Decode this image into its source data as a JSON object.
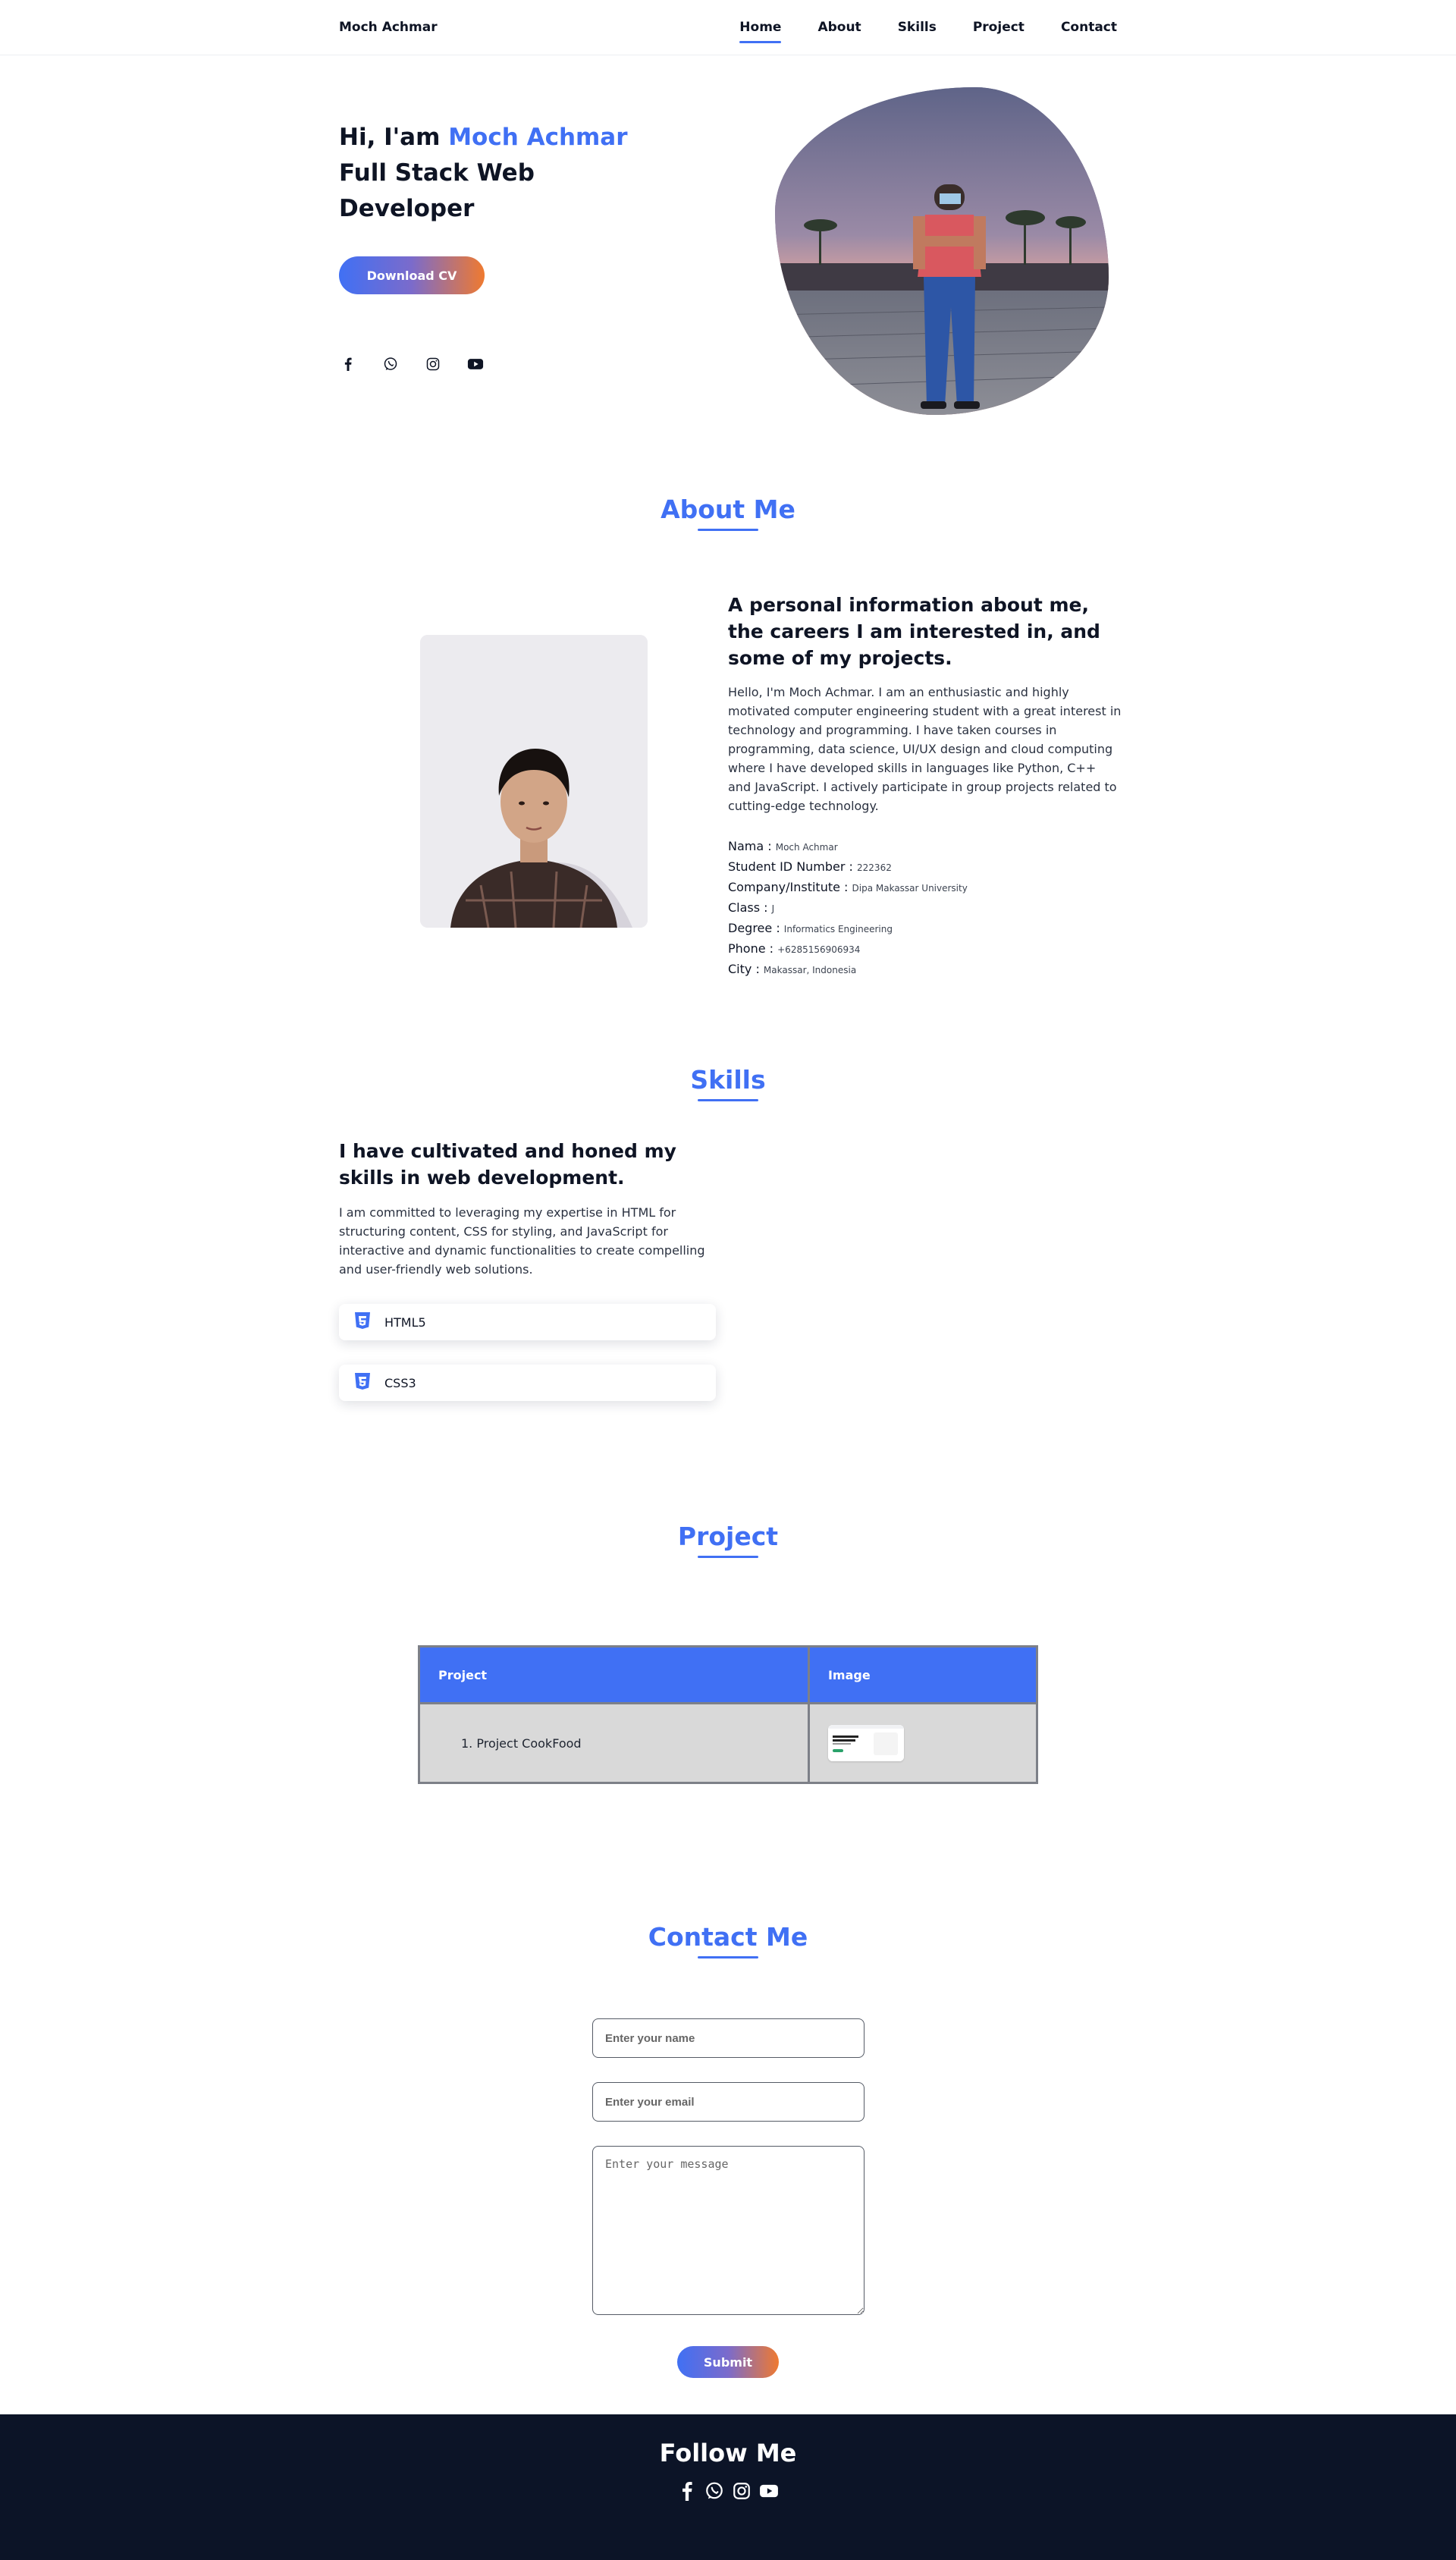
{
  "header": {
    "logo": "Moch Achmar",
    "nav": [
      "Home",
      "About",
      "Skills",
      "Project",
      "Contact"
    ],
    "active": "Home"
  },
  "hero": {
    "greeting": "Hi, I'am ",
    "name": "Moch Achmar",
    "role": "Full Stack Web Developer",
    "cv_button": "Download CV",
    "socials": [
      "facebook-icon",
      "whatsapp-icon",
      "instagram-icon",
      "youtube-icon"
    ]
  },
  "about": {
    "title": "About Me",
    "heading": "A personal information about me, the careers I am interested in, and some of my projects.",
    "text": "Hello, I'm Moch Achmar. I am an enthusiastic and highly motivated computer engineering student with a great interest in technology and programming. I have taken courses in programming, data science, UI/UX design and cloud computing where I have developed skills in languages like Python, C++ and JavaScript. I actively participate in group projects related to cutting-edge technology.",
    "info": [
      {
        "label": "Nama : ",
        "value": "Moch Achmar"
      },
      {
        "label": "Student ID Number : ",
        "value": "222362"
      },
      {
        "label": "Company/Institute : ",
        "value": "Dipa Makassar University"
      },
      {
        "label": "Class : ",
        "value": "J"
      },
      {
        "label": "Degree : ",
        "value": "Informatics Engineering"
      },
      {
        "label": "Phone : ",
        "value": "+6285156906934"
      },
      {
        "label": "City : ",
        "value": "Makassar, Indonesia"
      }
    ]
  },
  "skills": {
    "title": "Skills",
    "heading": "I have cultivated and honed my skills in web development.",
    "text": "I am committed to leveraging my expertise in HTML for structuring content, CSS for styling, and JavaScript for interactive and dynamic functionalities to create compelling and user-friendly web solutions.",
    "items": [
      {
        "name": "HTML5",
        "icon": "html5-icon"
      },
      {
        "name": "CSS3",
        "icon": "css3-icon"
      }
    ]
  },
  "project": {
    "title": "Project",
    "columns": [
      "Project",
      "Image"
    ],
    "rows": [
      {
        "name": "1. Project CookFood"
      }
    ]
  },
  "contact": {
    "title": "Contact Me",
    "name_placeholder": "Enter your name",
    "email_placeholder": "Enter your email",
    "message_placeholder": "Enter your message",
    "submit": "Submit"
  },
  "footer": {
    "title": "Follow Me",
    "socials": [
      "facebook-icon",
      "whatsapp-icon",
      "instagram-icon",
      "youtube-icon"
    ]
  },
  "colors": {
    "accent": "#4070f4",
    "gradient_end": "#ef7a30",
    "footer_bg": "#0c1427",
    "text_dark": "#0e1424"
  }
}
